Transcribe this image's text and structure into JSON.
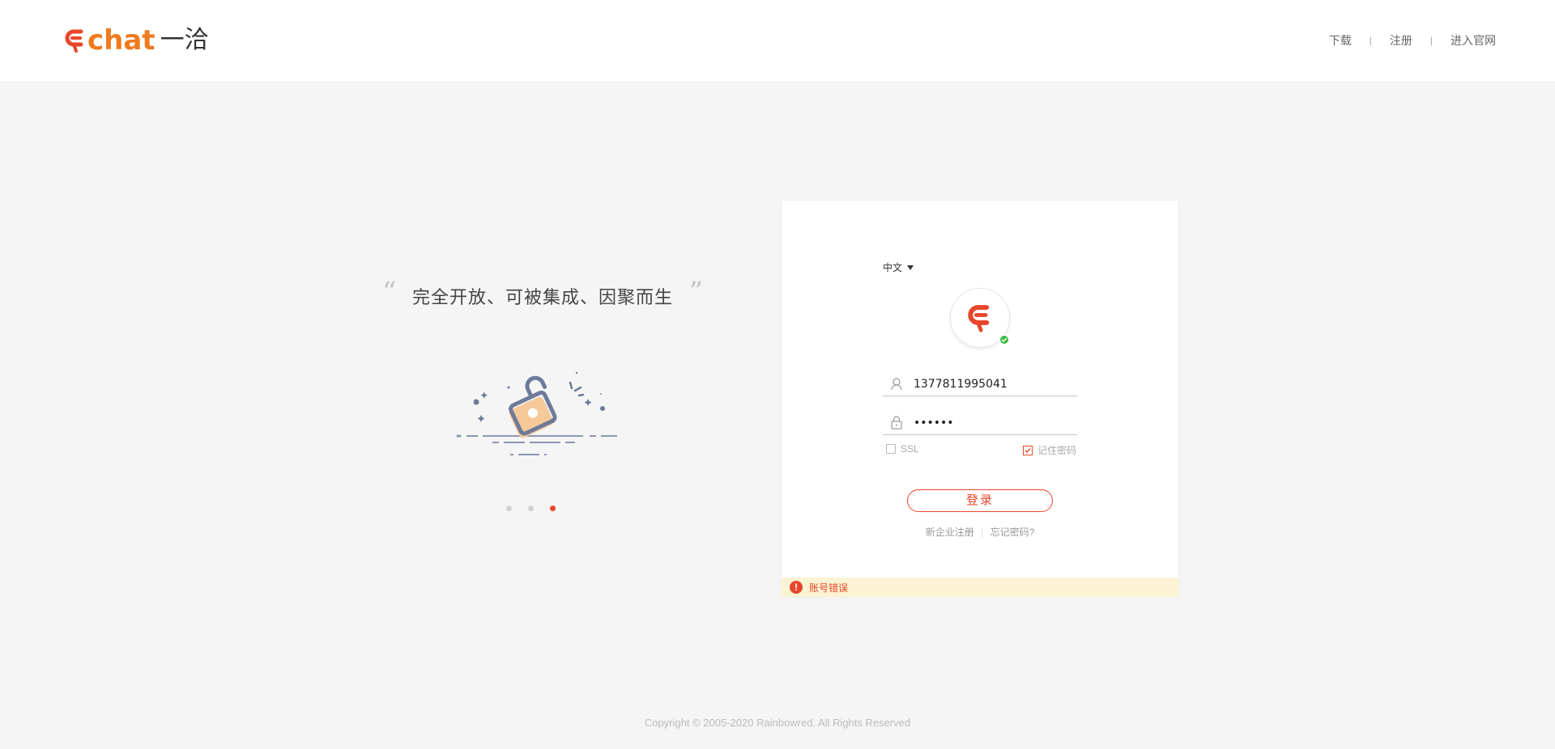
{
  "header": {
    "logo_text": "chat",
    "logo_cn": "一洽",
    "nav": {
      "download": "下载",
      "register": "注册",
      "official": "进入官网",
      "separator": "|"
    }
  },
  "promo": {
    "slogan": "完全开放、可被集成、因聚而生",
    "quote_open": "“",
    "quote_close": "”",
    "illustration_icon": "unlock-padlock-icon",
    "carousel": {
      "count": 3,
      "active_index": 2
    }
  },
  "login": {
    "language": "中文",
    "username_value": "13778119950​41",
    "password_value": "••••••",
    "ssl_label": "SSL",
    "ssl_checked": false,
    "remember_label": "记住密码",
    "remember_checked": true,
    "login_button": "登录",
    "new_company_register": "新企业注册",
    "forgot_password": "忘记密码?",
    "link_separator": "|",
    "error_message": "账号错误",
    "error_icon": "!"
  },
  "footer": {
    "copyright": "Copyright © 2005-2020 Rainbowred. All Rights Reserved"
  },
  "colors": {
    "brand_orange": "#f07a1e",
    "brand_red": "#e8462a",
    "status_green": "#3db93d",
    "error_bg": "#fbf3d4"
  }
}
